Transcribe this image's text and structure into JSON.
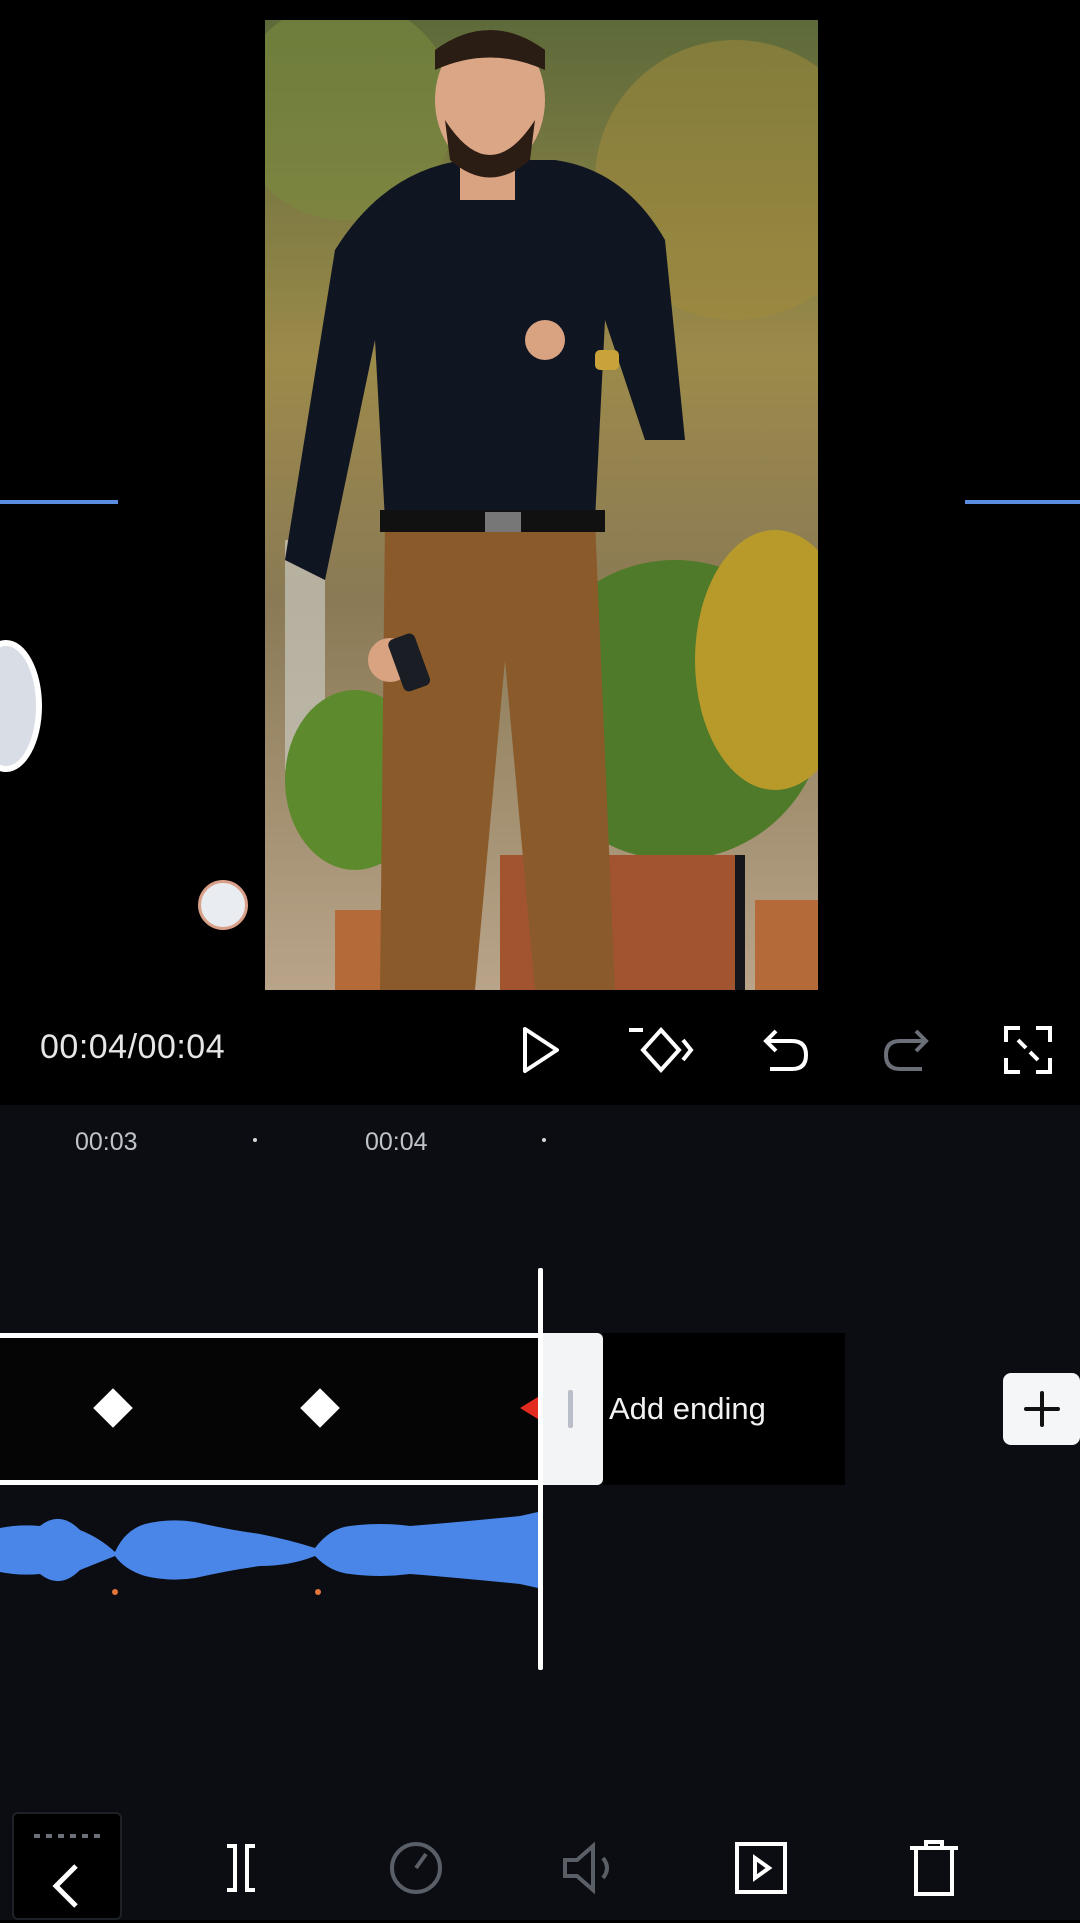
{
  "player": {
    "timecode": "00:04/00:04"
  },
  "controls": {
    "play_icon": "play-icon",
    "keyframe_icon": "keyframe-icon",
    "undo_icon": "undo-icon",
    "redo_icon": "redo-icon",
    "fullscreen_icon": "fullscreen-icon"
  },
  "timeline": {
    "ticks": [
      "00:03",
      "00:04"
    ],
    "add_ending_label": "Add ending",
    "add_clip_icon": "plus-icon"
  },
  "toolbar": {
    "items": [
      "back-icon",
      "split-icon",
      "speed-icon",
      "volume-icon",
      "animation-icon",
      "delete-icon"
    ]
  },
  "colors": {
    "accent_blue": "#4a86e8",
    "keyframe_active": "#e22a1e",
    "background": "#000000",
    "timeline_bg": "#0b0d12"
  }
}
